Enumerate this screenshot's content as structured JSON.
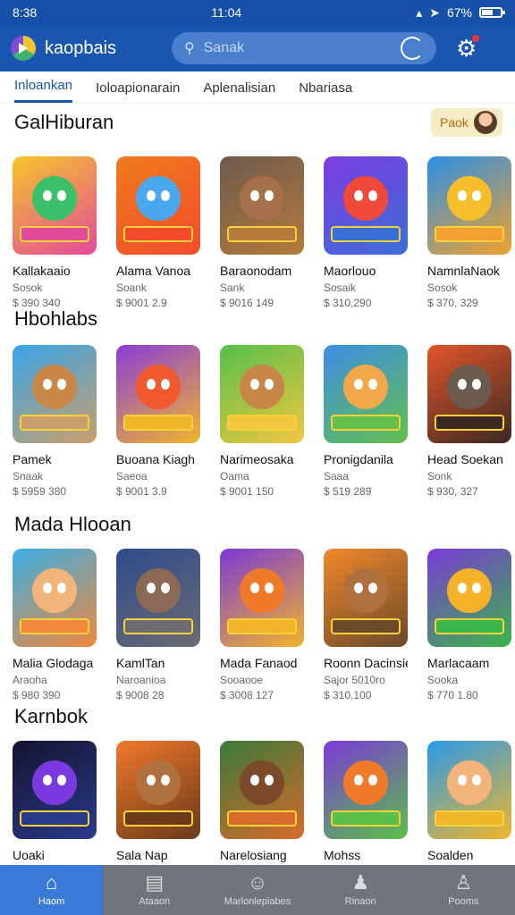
{
  "status": {
    "time_left": "8:38",
    "time_center": "11:04",
    "battery": "67%",
    "battery_level": 0.67
  },
  "appbar": {
    "title": "kaopbais",
    "search_placeholder": "Sanak"
  },
  "tabs": [
    "Inloankan",
    "Ioloapionarain",
    "Aplenalisian",
    "Nbariasa"
  ],
  "promo": {
    "label": "Paok"
  },
  "sections": [
    {
      "title": "GalHiburan",
      "items": [
        {
          "name": "Kallakaaio",
          "sub": "Sosok",
          "price": "$ 390 340",
          "colors": [
            "#f6c52b",
            "#e24a9a"
          ],
          "face": "#3cc06a"
        },
        {
          "name": "Alama Vanoa",
          "sub": "Soank",
          "price": "$ 9001 2.9",
          "colors": [
            "#ef7b1b",
            "#f34c2d"
          ],
          "face": "#4aa8ee"
        },
        {
          "name": "Baraonodam",
          "sub": "Sank",
          "price": "$ 9016 149",
          "colors": [
            "#6d5a4e",
            "#b57b3a"
          ],
          "face": "#a6704a"
        },
        {
          "name": "Maorlouo",
          "sub": "Sosaik",
          "price": "$ 310,290",
          "colors": [
            "#7c3ce0",
            "#3b6fd8"
          ],
          "face": "#f0483a"
        },
        {
          "name": "NamnlaNaok",
          "sub": "Sosok",
          "price": "$ 370, 329",
          "colors": [
            "#2b8fe6",
            "#f1a12f"
          ],
          "face": "#f6be2a"
        }
      ]
    },
    {
      "title": "Hbohlabs",
      "items": [
        {
          "name": "Pamek",
          "sub": "Snaak",
          "price": "$ 5959 380",
          "colors": [
            "#39a4e8",
            "#c9a06b"
          ],
          "face": "#c98748"
        },
        {
          "name": "Buoana Kiagh",
          "sub": "Saeoa",
          "price": "$ 9001 3.9",
          "colors": [
            "#8a3ed8",
            "#f1b52b"
          ],
          "face": "#f15a2e"
        },
        {
          "name": "Narimeosaka",
          "sub": "Oama",
          "price": "$ 9001 150",
          "colors": [
            "#54c04a",
            "#f3c640"
          ],
          "face": "#c78749"
        },
        {
          "name": "Pronigdanila",
          "sub": "Saaa",
          "price": "$ 519 289",
          "colors": [
            "#3c8ee4",
            "#63c04d"
          ],
          "face": "#f1a84b"
        },
        {
          "name": "Head Soekan",
          "sub": "Sonk",
          "price": "$ 930, 327",
          "colors": [
            "#e2552a",
            "#3b2a22"
          ],
          "face": "#6b5a4e"
        }
      ]
    },
    {
      "title": "Mada Hlooan",
      "items": [
        {
          "name": "Malia Glodaga",
          "sub": "Araoha",
          "price": "$ 980 390",
          "colors": [
            "#3ab0e6",
            "#f1873b"
          ],
          "face": "#f2b47a"
        },
        {
          "name": "KamlTan",
          "sub": "Naroanioa",
          "price": "$ 9008 28",
          "colors": [
            "#2e4b8e",
            "#6b6b72"
          ],
          "face": "#8a6a55"
        },
        {
          "name": "Mada Fanaod",
          "sub": "Sooaooe",
          "price": "$ 3008 127",
          "colors": [
            "#7b3ad6",
            "#f2b32b"
          ],
          "face": "#f07a2a"
        },
        {
          "name": "Roonn Dacinsie",
          "sub": "Sajor 5010ro",
          "price": "$ 310,100",
          "colors": [
            "#f0882a",
            "#6b4a2a"
          ],
          "face": "#b0703e"
        },
        {
          "name": "Marlacaam",
          "sub": "Sooka",
          "price": "$ 770 1.80",
          "colors": [
            "#7b3ad6",
            "#3ab54a"
          ],
          "face": "#f4b12a"
        }
      ]
    },
    {
      "title": "Karnbok",
      "items": [
        {
          "name": "Uoaki",
          "sub": "",
          "price": "",
          "colors": [
            "#141430",
            "#2a3a8a"
          ],
          "face": "#7a3ae0"
        },
        {
          "name": "Sala Nap",
          "sub": "",
          "price": "",
          "colors": [
            "#f0782a",
            "#6a3a1a"
          ],
          "face": "#b0713e"
        },
        {
          "name": "Narelosiang",
          "sub": "",
          "price": "",
          "colors": [
            "#3a7a3a",
            "#d86a2a"
          ],
          "face": "#7a4a2a"
        },
        {
          "name": "Mohss",
          "sub": "",
          "price": "",
          "colors": [
            "#7b3ad6",
            "#5ac04a"
          ],
          "face": "#f07a2a"
        },
        {
          "name": "Soalden",
          "sub": "",
          "price": "",
          "colors": [
            "#2a9ae8",
            "#f1b52b"
          ],
          "face": "#f2b47a"
        }
      ]
    }
  ],
  "bottom_nav": [
    {
      "label": "Haom",
      "icon": "home-icon",
      "active": true
    },
    {
      "label": "Ataaon",
      "icon": "document-icon",
      "active": false
    },
    {
      "label": "Marlonlepiabes",
      "icon": "face-icon",
      "active": false
    },
    {
      "label": "Rinaon",
      "icon": "people-icon",
      "active": false
    },
    {
      "label": "Pooms",
      "icon": "person-icon",
      "active": false
    }
  ]
}
